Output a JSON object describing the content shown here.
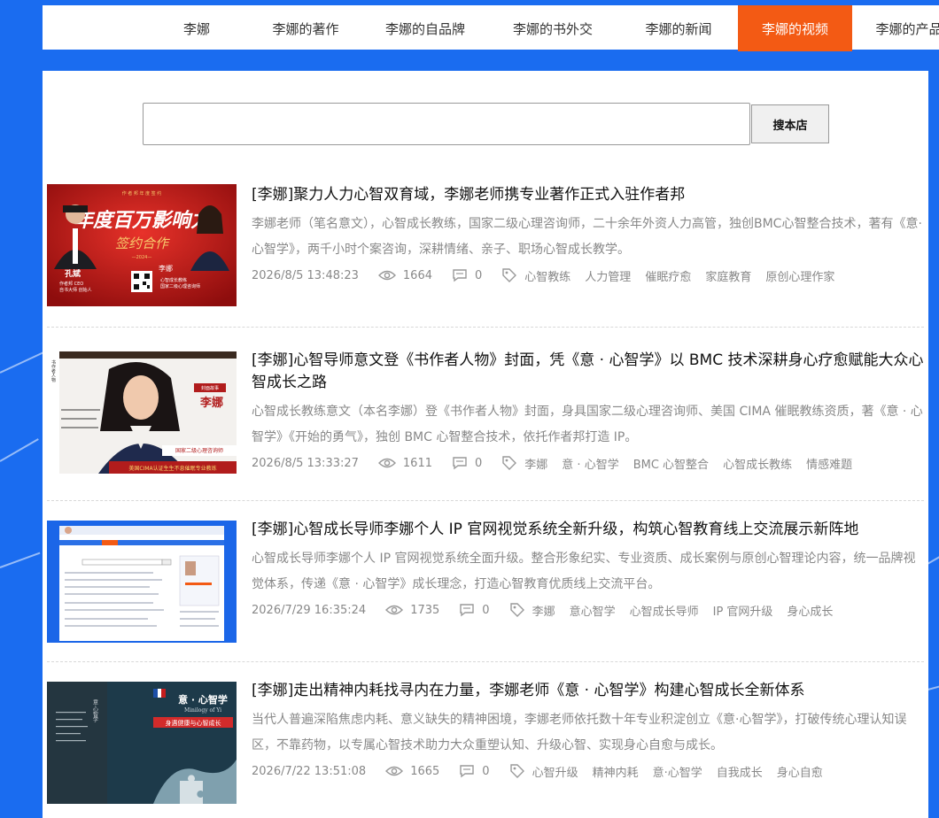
{
  "nav": {
    "items": [
      {
        "label": "李娜",
        "active": false
      },
      {
        "label": "李娜的著作",
        "active": false
      },
      {
        "label": "李娜的自品牌",
        "active": false
      },
      {
        "label": "李娜的书外交",
        "active": false
      },
      {
        "label": "李娜的新闻",
        "active": false
      },
      {
        "label": "李娜的视频",
        "active": true
      },
      {
        "label": "李娜的产品",
        "active": false
      }
    ]
  },
  "search": {
    "value": "",
    "button_label": "搜本店"
  },
  "colors": {
    "brand_blue": "#1a6cf0",
    "nav_active": "#f35a14"
  },
  "articles": [
    {
      "title": "[李娜]聚力人力心智双育域，李娜老师携专业著作正式入驻作者邦",
      "desc": "李娜老师（笔名意文），心智成长教练，国家二级心理咨询师，二十余年外资人力高管，独创BMC心智整合技术，著有《意·心智学》，两千小时个案咨询，深耕情绪、亲子、职场心智成长教学。",
      "date": "2026/8/5 13:48:23",
      "views": "1664",
      "comments": "0",
      "tags": [
        "心智教练",
        "人力管理",
        "催眠疗愈",
        "家庭教育",
        "原创心理作家"
      ],
      "thumb": {
        "top_text": "作 者 邦 年 度 签 约",
        "headline": "年度百万影响力",
        "sub": "签约合作",
        "year": "—2024—",
        "left_name": "孔斌",
        "left_role1": "作者邦 CEO",
        "left_role2": "自书大师 创始人",
        "right_name": "李娜",
        "right_role1": "心智成长教练",
        "right_role2": "国家二级心理咨询师"
      }
    },
    {
      "title": "[李娜]心智导师意文登《书作者人物》封面，凭《意 · 心智学》以 BMC 技术深耕身心疗愈赋能大众心智成长之路",
      "desc": "心智成长教练意文（本名李娜）登《书作者人物》封面，身具国家二级心理咨询师、美国 CIMA 催眠教练资质，著《意 · 心智学》《开始的勇气》，独创 BMC 心智整合技术，依托作者邦打造 IP。",
      "date": "2026/8/5 13:33:27",
      "views": "1611",
      "comments": "0",
      "tags": [
        "李娜",
        "意 · 心智学",
        "BMC 心智整合",
        "心智成长教练",
        "情感难题"
      ],
      "thumb": {
        "side": "书作者人物",
        "badge": "封面故事",
        "name": "李娜",
        "role": "国家二级心理咨询师",
        "bottom": "美国CIMA认证生生不息催眠专业教练"
      }
    },
    {
      "title": "[李娜]心智成长导师李娜个人 IP 官网视觉系统全新升级，构筑心智教育线上交流展示新阵地",
      "desc": "心智成长导师李娜个人 IP 官网视觉系统全面升级。整合形象纪实、专业资质、成长案例与原创心智理论内容，统一品牌视觉体系，传递《意 · 心智学》成长理念，打造心智教育优质线上交流平台。",
      "date": "2026/7/29 16:35:24",
      "views": "1735",
      "comments": "0",
      "tags": [
        "李娜",
        "意心智学",
        "心智成长导师",
        "IP 官网升级",
        "身心成长"
      ],
      "thumb": {}
    },
    {
      "title": "[李娜]走出精神内耗找寻内在力量，李娜老师《意 · 心智学》构建心智成长全新体系",
      "desc": "当代人普遍深陷焦虑内耗、意义缺失的精神困境，李娜老师依托数十年专业积淀创立《意·心智学》，打破传统心理认知误区，不靠药物，以专属心智技术助力大众重塑认知、升级心智、实现身心自愈与成长。",
      "date": "2026/7/22 13:51:08",
      "views": "1665",
      "comments": "0",
      "tags": [
        "心智升级",
        "精神内耗",
        "意·心智学",
        "自我成长",
        "身心自愈"
      ],
      "thumb": {
        "book_title": "意 · 心智学",
        "book_en": "Minilogy of Yi",
        "book_sub": "身遇健康与心智成长",
        "spine": "意·心智学"
      }
    }
  ]
}
